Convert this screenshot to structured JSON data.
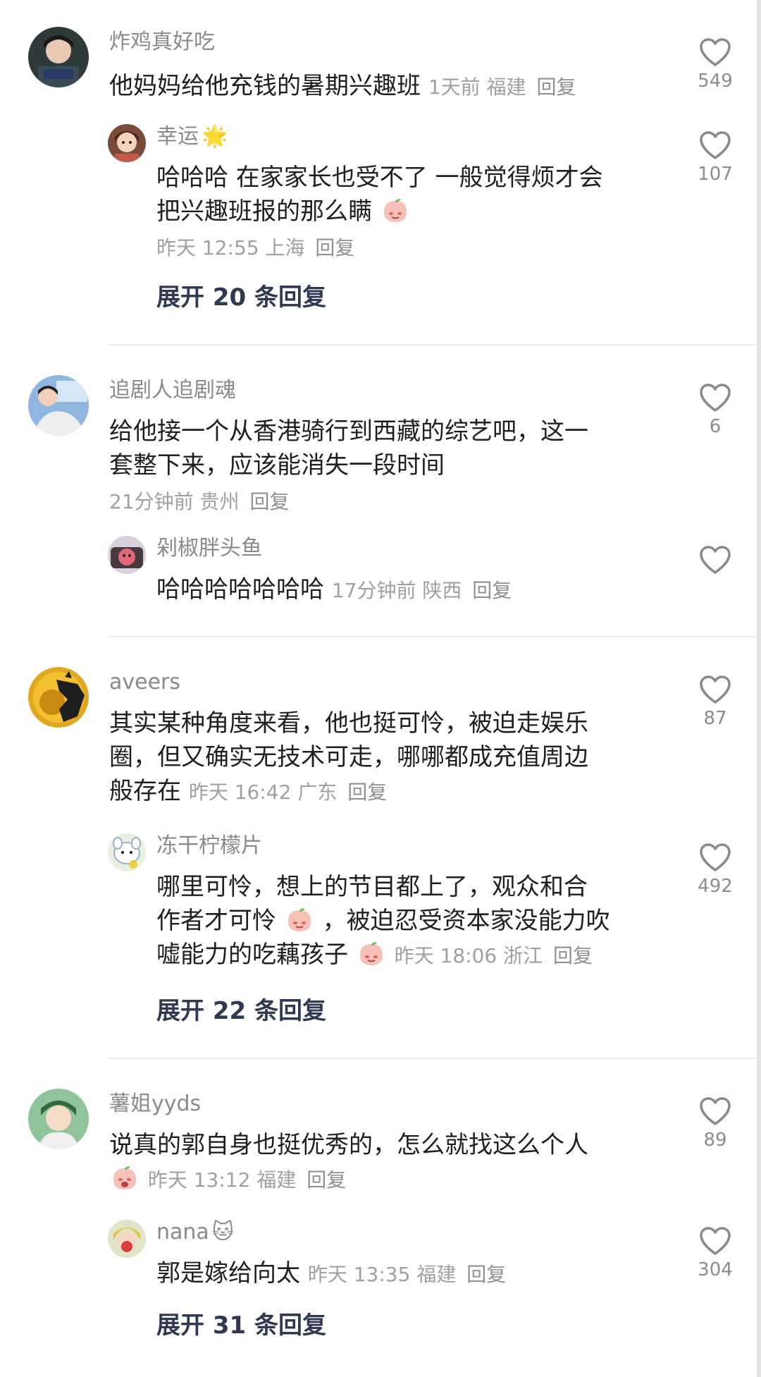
{
  "threads": [
    {
      "comment": {
        "user": "炸鸡真好吃",
        "text": "他妈妈给他充钱的暑期兴趣班",
        "time": "1天前",
        "location": "福建",
        "reply_label": "回复",
        "likes": "549"
      },
      "replies": [
        {
          "user": "幸运",
          "badge": "🌟",
          "text_line1": "哈哈哈 在家家长也受不了 一般觉得烦才会",
          "text_line2": "把兴趣班报的那么瞒",
          "time": "昨天 12:55",
          "location": "上海",
          "reply_label": "回复",
          "likes": "107"
        }
      ],
      "expand_label": "展开 20 条回复"
    },
    {
      "comment": {
        "user": "追剧人追剧魂",
        "text_line1": "给他接一个从香港骑行到西藏的综艺吧，这一",
        "text_line2": "套整下来，应该能消失一段时间",
        "time": "21分钟前",
        "location": "贵州",
        "reply_label": "回复",
        "likes": "6"
      },
      "replies": [
        {
          "user": "剁椒胖头鱼",
          "text": "哈哈哈哈哈哈哈",
          "time": "17分钟前",
          "location": "陕西",
          "reply_label": "回复",
          "likes": ""
        }
      ]
    },
    {
      "comment": {
        "user": "aveers",
        "text_line1": "其实某种角度来看，他也挺可怜，被迫走娱乐",
        "text_line2": "圈，但又确实无技术可走，哪哪都成充值周边",
        "text_line3": "般存在",
        "time": "昨天 16:42",
        "location": "广东",
        "reply_label": "回复",
        "likes": "87"
      },
      "replies": [
        {
          "user": "冻干柠檬片",
          "text_line1": "哪里可怜，想上的节目都上了，观众和合",
          "text_line2a": "作者才可怜",
          "text_line2b": "，被迫忍受资本家没能力吹",
          "text_line3": "嘘能力的吃藕孩子",
          "time": "昨天 18:06",
          "location": "浙江",
          "reply_label": "回复",
          "likes": "492"
        }
      ],
      "expand_label": "展开 22 条回复"
    },
    {
      "comment": {
        "user": "薯姐yyds",
        "text": "说真的郭自身也挺优秀的，怎么就找这么个人",
        "time": "昨天 13:12",
        "location": "福建",
        "reply_label": "回复",
        "likes": "89"
      },
      "replies": [
        {
          "user": "nana",
          "badge": "🐱",
          "text": "郭是嫁给向太",
          "time": "昨天 13:35",
          "location": "福建",
          "reply_label": "回复",
          "likes": "304"
        }
      ],
      "expand_label": "展开 31 条回复"
    }
  ],
  "colors": {
    "accent": "#2f3a52",
    "meta": "#a0a0a0",
    "username": "#8a8a8a",
    "divider": "#ededed"
  },
  "icons": {
    "like": "heart-outline-icon",
    "emoji": "peach-face-emoji"
  }
}
